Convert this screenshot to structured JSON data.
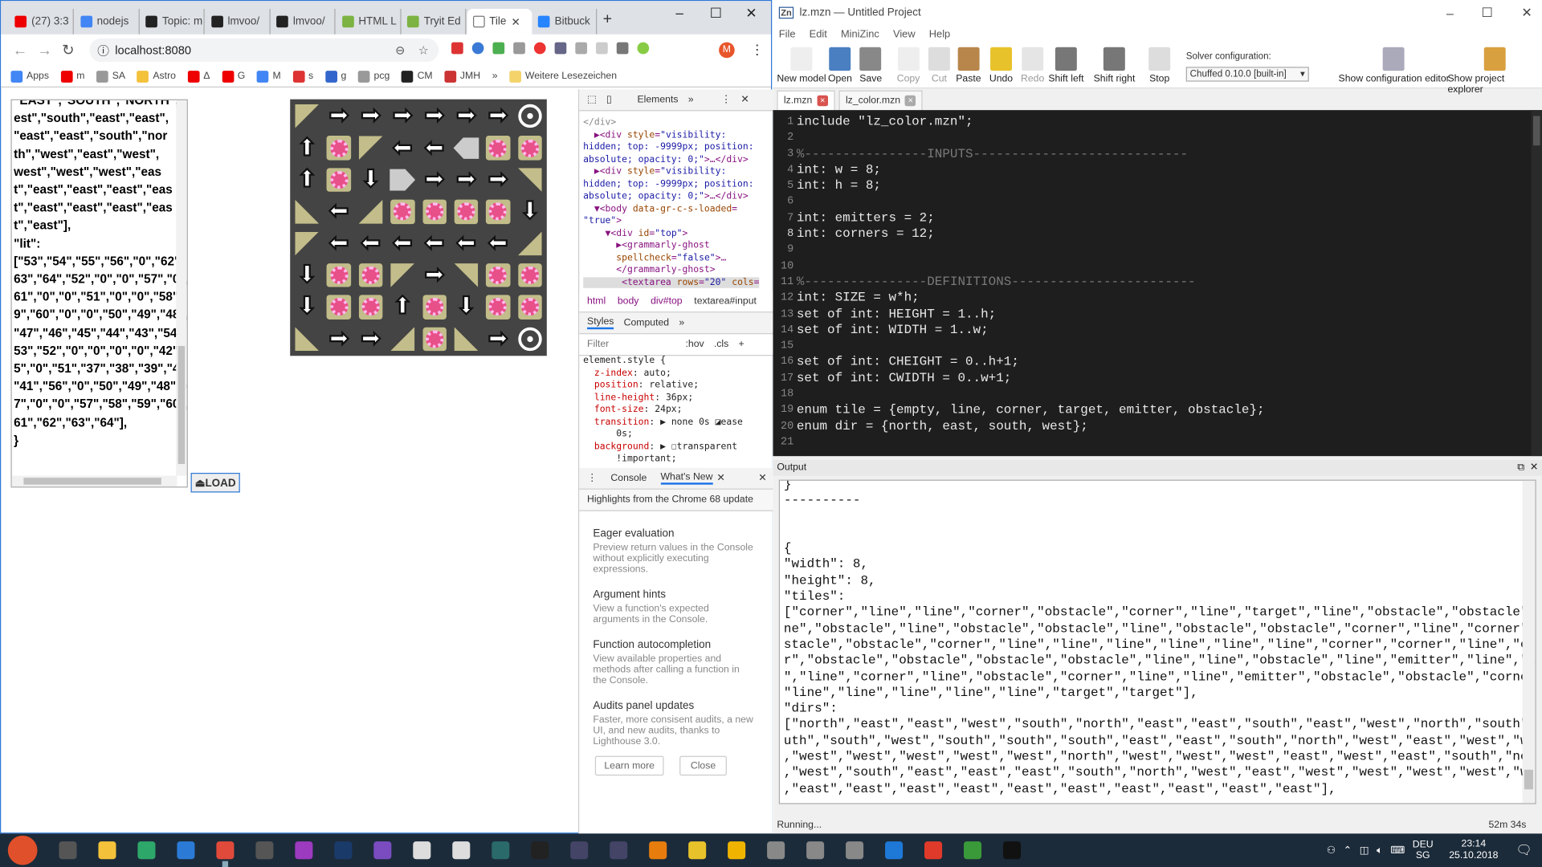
{
  "browser": {
    "tabs": [
      {
        "label": "(27) 3:3",
        "color": "#e00"
      },
      {
        "label": "nodejs",
        "color": "#4285f4"
      },
      {
        "label": "Topic: m",
        "color": "#222"
      },
      {
        "label": "lmvoo/",
        "color": "#222"
      },
      {
        "label": "lmvoo/",
        "color": "#222"
      },
      {
        "label": "HTML L",
        "color": "#7cb342"
      },
      {
        "label": "Tryit Ed",
        "color": "#7cb342"
      },
      {
        "label": "Tile",
        "color": "#fff"
      },
      {
        "label": "Bitbuck",
        "color": "#2684ff"
      }
    ],
    "new_tab": "+",
    "url": "localhost:8080",
    "bookmarks": [
      "Apps",
      "m",
      "SA",
      "Astro",
      "Δ",
      "G",
      "M",
      "s",
      "g",
      "pcg",
      "CM",
      "JMH"
    ],
    "bookmarks_more": "»",
    "other_bookmarks": "Weitere Lesezeichen",
    "profile": "M"
  },
  "page": {
    "textarea": "\"EAST\",\"SOUTH\",\"NORTH\",\"\nest\",\"south\",\"east\",\"east\",\n\"east\",\"east\",\"south\",\"nor\nth\",\"west\",\"east\",\"west\",\nwest\",\"west\",\"west\",\"eas\nt\",\"east\",\"east\",\"east\",\"eas\nt\",\"east\",\"east\",\"east\",\"eas\nt\",\"east\"],\n\"lit\":\n[\"53\",\"54\",\"55\",\"56\",\"0\",\"62\",\n63\",\"64\",\"52\",\"0\",\"0\",\"57\",\"0\",\n61\",\"0\",\"0\",\"51\",\"0\",\"0\",\"58\",\"5\n9\",\"60\",\"0\",\"0\",\"50\",\"49\",\"48\",\n\"47\",\"46\",\"45\",\"44\",\"43\",\"54\",\n53\",\"52\",\"0\",\"0\",\"0\",\"0\",\"42\",\"5\n5\",\"0\",\"51\",\"37\",\"38\",\"39\",\"40\",\n\"41\",\"56\",\"0\",\"50\",\"49\",\"48\",\"4\n7\",\"0\",\"0\",\"57\",\"58\",\"59\",\"60\",\n61\",\"62\",\"63\",\"64\"],\n}",
    "load_button": "⏏LOAD",
    "grid": [
      [
        "corner-tl",
        "R",
        "R",
        "R",
        "R",
        "R",
        "R",
        "target"
      ],
      [
        "U",
        "obstacle",
        "corner-tl",
        "L",
        "L",
        "emitter-left",
        "obstacle",
        "obstacle"
      ],
      [
        "U",
        "obstacle",
        "D",
        "emitter-right",
        "R",
        "R",
        "R",
        "corner-tr"
      ],
      [
        "corner-bl",
        "L",
        "corner-br",
        "obstacle",
        "obstacle",
        "obstacle",
        "obstacle",
        "D"
      ],
      [
        "corner-tl",
        "L",
        "L",
        "L",
        "L",
        "L",
        "L",
        "corner-br"
      ],
      [
        "D",
        "obstacle",
        "obstacle",
        "corner-tl",
        "R",
        "corner-tr",
        "obstacle",
        "obstacle"
      ],
      [
        "D",
        "obstacle",
        "obstacle",
        "U",
        "obstacle",
        "D",
        "obstacle",
        "obstacle"
      ],
      [
        "corner-bl",
        "R",
        "R",
        "corner-br",
        "obstacle",
        "corner-bl",
        "R",
        "target"
      ]
    ]
  },
  "devtools": {
    "tab": "Elements",
    "more": "»",
    "breadcrumb": [
      "html",
      "body",
      "div#top",
      "textarea#input"
    ],
    "styles_tabs": [
      "Styles",
      "Computed"
    ],
    "filter_placeholder": "Filter",
    "hov": ":hov",
    "cls": ".cls",
    "add": "+",
    "drawer_tabs": [
      "Console",
      "What's New"
    ],
    "highlights": "Highlights from the Chrome 68 update",
    "items": [
      {
        "title": "Eager evaluation",
        "desc": "Preview return values in the Console without explicitly executing expressions."
      },
      {
        "title": "Argument hints",
        "desc": "View a function's expected arguments in the Console."
      },
      {
        "title": "Function autocompletion",
        "desc": "View available properties and methods after calling a function in the Console."
      },
      {
        "title": "Audits panel updates",
        "desc": "Faster, more consisent audits, a new UI, and new audits, thanks to Lighthouse 3.0."
      }
    ],
    "learn_more": "Learn more",
    "close": "Close"
  },
  "minizinc": {
    "title": "lz.mzn — Untitled Project",
    "menu": [
      "File",
      "Edit",
      "MiniZinc",
      "View",
      "Help"
    ],
    "tools": [
      {
        "label": "New model",
        "color": "#eee"
      },
      {
        "label": "Open",
        "color": "#4a7fc1"
      },
      {
        "label": "Save",
        "color": "#888"
      },
      {
        "label": "Copy",
        "color": "#ddd",
        "disabled": true
      },
      {
        "label": "Cut",
        "color": "#bbb",
        "disabled": true
      },
      {
        "label": "Paste",
        "color": "#b8864b"
      },
      {
        "label": "Undo",
        "color": "#e8c22a"
      },
      {
        "label": "Redo",
        "color": "#ccc",
        "disabled": true
      },
      {
        "label": "Shift left",
        "color": "#777"
      },
      {
        "label": "Shift right",
        "color": "#777"
      },
      {
        "label": "Stop",
        "color": "#ddd"
      }
    ],
    "solver_label": "Solver configuration:",
    "solver": "Chuffed 0.10.0 [built-in]",
    "show_config": "Show configuration editor",
    "show_explorer": "Show project explorer",
    "files": [
      "lz.mzn",
      "lz_color.mzn"
    ],
    "code": [
      "include \"lz_color.mzn\";",
      "",
      "%----------------INPUTS----------------------------",
      "int: w = 8;",
      "int: h = 8;",
      "",
      "int: emitters = 2;",
      "int: corners = 12;",
      "",
      "",
      "%----------------DEFINITIONS------------------------",
      "int: SIZE = w*h;",
      "set of int: HEIGHT = 1..h;",
      "set of int: WIDTH = 1..w;",
      "",
      "set of int: CHEIGHT = 0..h+1;",
      "set of int: CWIDTH = 0..w+1;",
      "",
      "enum tile = {empty, line, corner, target, emitter, obstacle};",
      "enum dir = {north, east, south, west};",
      ""
    ],
    "output_label": "Output",
    "output": "}\n----------\n\n\n{\n\"width\": 8,\n\"height\": 8,\n\"tiles\":\n[\"corner\",\"line\",\"line\",\"corner\",\"obstacle\",\"corner\",\"line\",\"target\",\"line\",\"obstacle\",\"obstacle\",\"li\nne\",\"obstacle\",\"line\",\"obstacle\",\"obstacle\",\"line\",\"obstacle\",\"obstacle\",\"corner\",\"line\",\"corner\",\"ob\nstacle\",\"obstacle\",\"corner\",\"line\",\"line\",\"line\",\"line\",\"line\",\"line\",\"corner\",\"corner\",\"line\",\"corne\nr\",\"obstacle\",\"obstacle\",\"obstacle\",\"obstacle\",\"line\",\"line\",\"obstacle\",\"line\",\"emitter\",\"line\",\"line\n\",\"line\",\"corner\",\"line\",\"obstacle\",\"corner\",\"line\",\"line\",\"emitter\",\"obstacle\",\"obstacle\",\"corner\",\n\"line\",\"line\",\"line\",\"line\",\"line\",\"target\",\"target\"],\n\"dirs\":\n[\"north\",\"east\",\"east\",\"west\",\"south\",\"north\",\"east\",\"east\",\"south\",\"east\",\"west\",\"north\",\"south\",\"so\nuth\",\"south\",\"west\",\"south\",\"south\",\"south\",\"east\",\"east\",\"south\",\"north\",\"west\",\"east\",\"west\",\"west\"\n,\"west\",\"west\",\"west\",\"west\",\"west\",\"north\",\"west\",\"west\",\"west\",\"east\",\"west\",\"east\",\"south\",\"north\"\n,\"west\",\"south\",\"east\",\"east\",\"east\",\"south\",\"north\",\"west\",\"east\",\"west\",\"west\",\"west\",\"west\",\"west\"\n,\"east\",\"east\",\"east\",\"east\",\"east\",\"east\",\"east\",\"east\",\"east\",\"east\"],",
    "status": "Running...",
    "elapsed": "52m 34s"
  },
  "taskbar": {
    "apps": [
      {
        "name": "start",
        "color": "#e0502a"
      },
      {
        "name": "task-view",
        "color": "#555"
      },
      {
        "name": "file-explorer",
        "color": "#f3c13a"
      },
      {
        "name": "app",
        "color": "#2ea86a"
      },
      {
        "name": "vscode",
        "color": "#2b7bd6"
      },
      {
        "name": "chrome",
        "color": "#e04a3a"
      },
      {
        "name": "store",
        "color": "#555"
      },
      {
        "name": "minizinc-m",
        "color": "#9c3ac0"
      },
      {
        "name": "photoshop",
        "color": "#1a3a6a"
      },
      {
        "name": "visual-studio",
        "color": "#7a4cc0"
      },
      {
        "name": "unity",
        "color": "#ddd"
      },
      {
        "name": "minizinc",
        "color": "#ddd"
      },
      {
        "name": "app",
        "color": "#2a6a6a"
      },
      {
        "name": "k",
        "color": "#222"
      },
      {
        "name": "app",
        "color": "#446"
      },
      {
        "name": "app",
        "color": "#446"
      },
      {
        "name": "blender",
        "color": "#e87d0d"
      },
      {
        "name": "app",
        "color": "#e8c22a"
      },
      {
        "name": "app",
        "color": "#f0b400"
      },
      {
        "name": "app",
        "color": "#888"
      },
      {
        "name": "app",
        "color": "#888"
      },
      {
        "name": "app",
        "color": "#888"
      },
      {
        "name": "edge",
        "color": "#1e78d6"
      },
      {
        "name": "app",
        "color": "#e03a2a"
      },
      {
        "name": "app",
        "color": "#3a9a3a"
      },
      {
        "name": "terminal",
        "color": "#111"
      }
    ],
    "lang": "DEU",
    "lang2": "SG",
    "time": "23:14",
    "date": "25.10.2018"
  }
}
